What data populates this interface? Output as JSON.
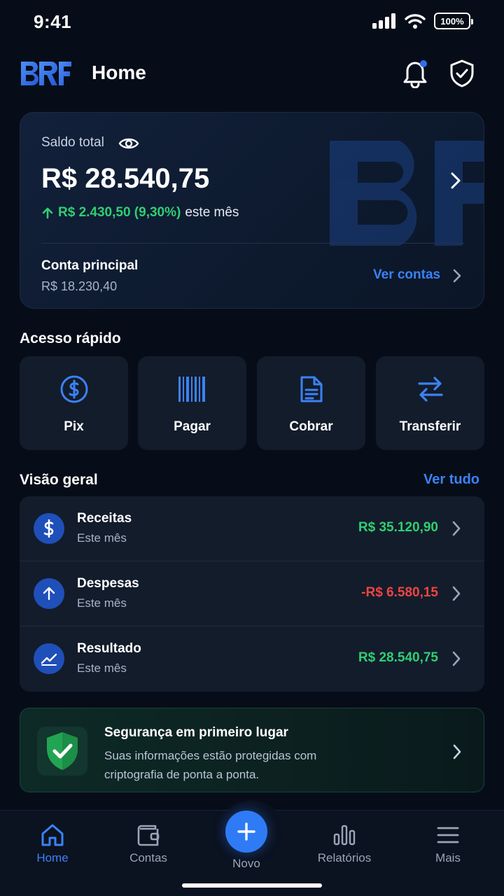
{
  "status_bar": {
    "time": "9:41",
    "battery": "100%"
  },
  "header": {
    "logo_text": "BRF",
    "title": "Home"
  },
  "balance": {
    "label": "Saldo total",
    "value": "R$ 28.540,75",
    "change": "R$ 2.430,50 (9,30%)",
    "change_suffix": "este mês",
    "account_label": "Conta principal",
    "account_value": "R$ 18.230,40",
    "see_accounts": "Ver contas"
  },
  "quick_access": {
    "title": "Acesso rápido",
    "items": [
      {
        "label": "Pix",
        "icon": "dollar-circle-icon"
      },
      {
        "label": "Pagar",
        "icon": "barcode-icon"
      },
      {
        "label": "Cobrar",
        "icon": "document-icon"
      },
      {
        "label": "Transferir",
        "icon": "transfer-arrows-icon"
      }
    ]
  },
  "overview": {
    "title": "Visão geral",
    "see_all": "Ver tudo",
    "rows": [
      {
        "name": "Receitas",
        "sub": "Este mês",
        "value": "R$ 35.120,90",
        "tone": "positive",
        "icon": "dollar-icon"
      },
      {
        "name": "Despesas",
        "sub": "Este mês",
        "value": "-R$ 6.580,15",
        "tone": "negative",
        "icon": "arrow-up-icon"
      },
      {
        "name": "Resultado",
        "sub": "Este mês",
        "value": "R$ 28.540,75",
        "tone": "positive",
        "icon": "trend-line-icon"
      }
    ]
  },
  "security": {
    "title": "Segurança em primeiro lugar",
    "description": "Suas informações estão protegidas com criptografia de ponta a ponta."
  },
  "bottom_nav": {
    "items": [
      {
        "label": "Home",
        "active": true
      },
      {
        "label": "Contas",
        "active": false
      },
      {
        "label": "Novo",
        "active": false
      },
      {
        "label": "Relatórios",
        "active": false
      },
      {
        "label": "Mais",
        "active": false
      }
    ]
  },
  "colors": {
    "accent": "#3b82f6",
    "positive": "#2fcf73",
    "negative": "#ef4444",
    "background": "#070d18",
    "card": "#131c2b"
  }
}
